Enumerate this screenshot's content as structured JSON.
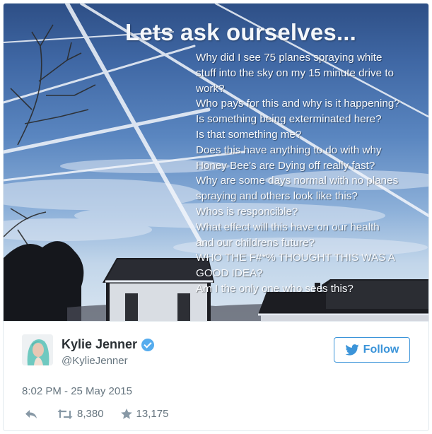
{
  "image": {
    "headline": "Lets ask ourselves...",
    "lines": [
      "Why did I see 75 planes spraying white",
      "stuff into the sky on my 15 minute drive to",
      "work?",
      "Who pays for this and why is it happening?",
      "Is something being exterminated here?",
      "Is that something me?",
      "Does this have anything to do with why",
      "Honey Bee's are Dying off really fast?",
      "Why are some days normal with no planes",
      "spraying and others look like this?",
      "Whos is responcible?",
      "What effect will this have on our health",
      "and our childrens future?",
      "WHO THE F#*% THOUGHT THIS WAS A",
      "GOOD IDEA?",
      "Am I the only one who sees this?"
    ]
  },
  "author": {
    "name": "Kylie Jenner",
    "handle": "@KylieJenner",
    "verified": true
  },
  "follow_button": {
    "label": "Follow",
    "color": "#3b94d9"
  },
  "timestamp": "8:02 PM - 25 May 2015",
  "actions": {
    "reply_icon": "reply-icon",
    "retweet_icon": "retweet-icon",
    "retweets": "8,380",
    "favorite_icon": "star-icon",
    "favorites": "13,175"
  },
  "colors": {
    "accent": "#3b94d9",
    "verified": "#55acee",
    "text_primary": "#292f33",
    "text_secondary": "#66757f"
  }
}
